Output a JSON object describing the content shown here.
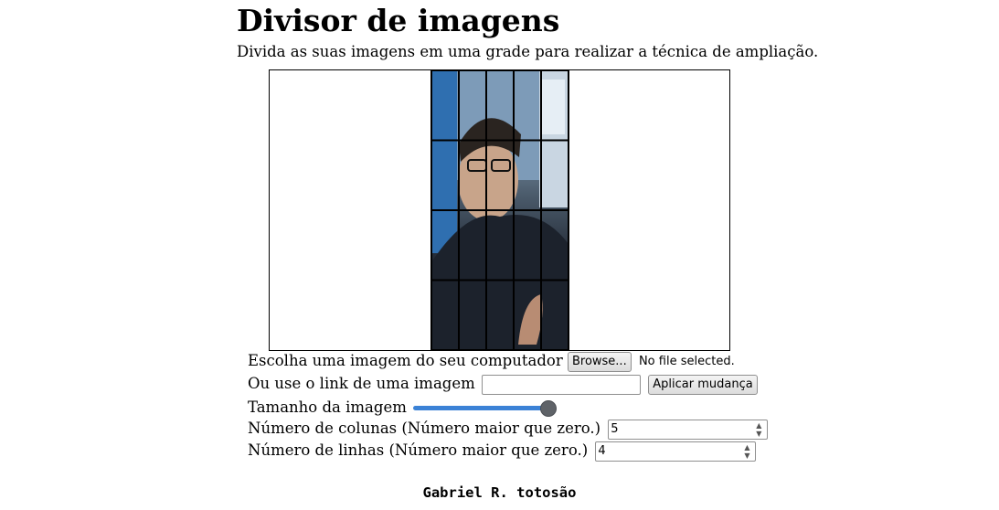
{
  "header": {
    "title": "Divisor de imagens",
    "subtitle": "Divida as suas imagens em uma grade para realizar a técnica de ampliação."
  },
  "canvas": {
    "grid_columns": 5,
    "grid_rows": 4,
    "image_content": "selfie-photo"
  },
  "controls": {
    "file_label": "Escolha uma imagem do seu computador",
    "browse_button": "Browse...",
    "file_status": "No file selected.",
    "link_label": "Ou use o link de uma imagem",
    "link_value": "",
    "apply_button": "Aplicar mudança",
    "size_label": "Tamanho da imagem",
    "size_slider_level": 1.0,
    "columns_label": "Número de colunas (Número maior que zero.)",
    "columns_value": "5",
    "rows_label": "Número de linhas (Número maior que zero.)",
    "rows_value": "4"
  },
  "footer": {
    "author": "Gabriel R. totosão"
  },
  "colors": {
    "slider_fill": "#3b82d6",
    "slider_thumb": "#5f6368"
  }
}
